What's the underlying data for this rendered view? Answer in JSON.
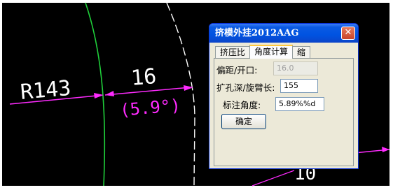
{
  "drawing": {
    "radius_label": "R143",
    "dimension_value": "16",
    "angle_label": "(5.9°)",
    "partial_text": "10"
  },
  "dialog": {
    "title": "挤模外挂2012AAG",
    "close_glyph": "✕",
    "tabs": [
      {
        "label": "挤压比",
        "active": false
      },
      {
        "label": "角度计算",
        "active": true
      },
      {
        "label": "缩",
        "active": false
      }
    ],
    "fields": {
      "offset_label": "偏距/开口:",
      "offset_value": "16.0",
      "depth_label": "扩孔深/旋臂长:",
      "depth_value": "155",
      "angle_label": "标注角度:",
      "angle_value": "5.89%%d"
    },
    "ok_label": "确定"
  },
  "colors": {
    "cad_background": "#000000",
    "arc_green": "#1fcf3a",
    "dimension_magenta": "#ff2bff",
    "titlebar_blue": "#0053e1"
  }
}
